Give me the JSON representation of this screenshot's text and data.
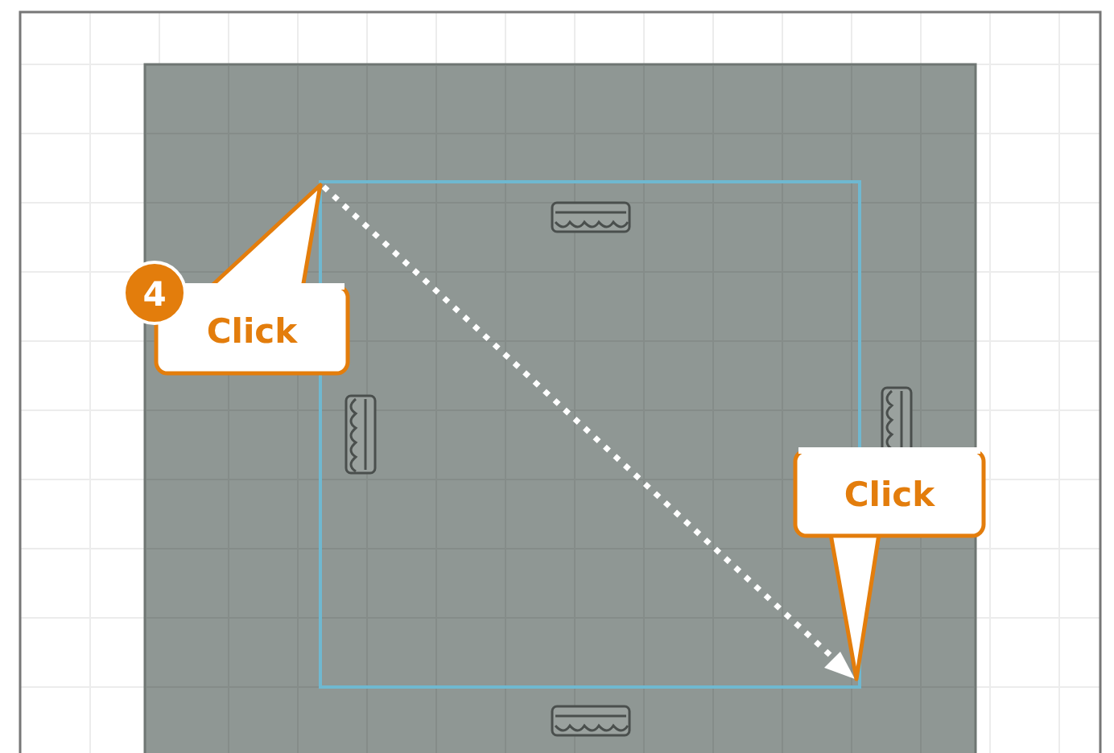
{
  "canvas": {
    "callouts": [
      {
        "step": "4",
        "label": "Click"
      },
      {
        "label": "Click"
      }
    ]
  }
}
